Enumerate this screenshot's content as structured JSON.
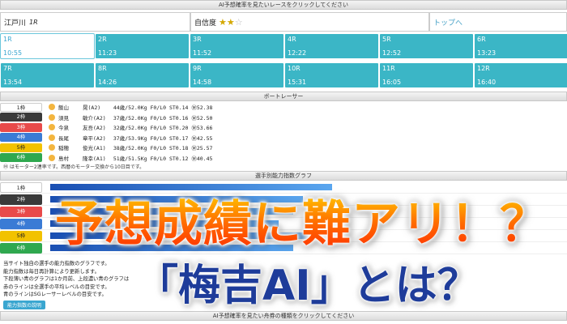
{
  "header": {
    "top_banner": "AI予想確率を見たいレースをクリックしてください",
    "venue": "江戸川",
    "race": "1R",
    "confidence_label": "自信度",
    "confidence_stars": 2,
    "confidence_max": 3,
    "top_link": "トップへ"
  },
  "races": [
    {
      "label": "1R",
      "time": "10:55",
      "active": true
    },
    {
      "label": "2R",
      "time": "11:23"
    },
    {
      "label": "3R",
      "time": "11:52"
    },
    {
      "label": "4R",
      "time": "12:22"
    },
    {
      "label": "5R",
      "time": "12:52"
    },
    {
      "label": "6R",
      "time": "13:23"
    },
    {
      "label": "7R",
      "time": "13:54"
    },
    {
      "label": "8R",
      "time": "14:26"
    },
    {
      "label": "9R",
      "time": "14:58"
    },
    {
      "label": "10R",
      "time": "15:31"
    },
    {
      "label": "11R",
      "time": "16:05"
    },
    {
      "label": "12R",
      "time": "16:40"
    }
  ],
  "racer_section": {
    "title": "ボートレーサー",
    "racers": [
      {
        "boat": "1枠",
        "color": "#ffffff",
        "text_color": "#222222",
        "name": "飯山",
        "class": "晃(A2)",
        "rest": "44歳/52.0Kg F0/L0 ST0.14 Ⓜ52.38"
      },
      {
        "boat": "2枠",
        "color": "#3a3a3a",
        "text_color": "#ffffff",
        "name": "須見",
        "class": "敏介(A2)",
        "rest": "37歳/52.0Kg F0/L0 ST0.16 Ⓜ52.50"
      },
      {
        "boat": "3枠",
        "color": "#e84a4a",
        "text_color": "#ffffff",
        "name": "今泉",
        "class": "友吾(A2)",
        "rest": "32歳/52.0Kg F0/L0 ST0.20 Ⓜ53.66"
      },
      {
        "boat": "4枠",
        "color": "#3a7bd5",
        "text_color": "#ffffff",
        "name": "長尾",
        "class": "章平(A2)",
        "rest": "37歳/53.9Kg F0/L0 ST0.17 Ⓜ42.55"
      },
      {
        "boat": "5枠",
        "color": "#f2c200",
        "text_color": "#222222",
        "name": "稲穂",
        "class": "俊光(A1)",
        "rest": "38歳/52.0Kg F0/L0 ST0.18 Ⓜ25.57"
      },
      {
        "boat": "6枠",
        "color": "#2fa84f",
        "text_color": "#ffffff",
        "name": "島村",
        "class": "隆幸(A1)",
        "rest": "51歳/51.5Kg F0/L0 ST0.12 Ⓜ40.45"
      }
    ],
    "motor_note": "Ⓜ はモーター2連率です。西暦のモーター交換から10日目です。"
  },
  "graph_section": {
    "title": "選手別能力指数グラフ",
    "rows": [
      {
        "boat": "1枠",
        "color": "#ffffff",
        "text_color": "#222222",
        "value": 0.58
      },
      {
        "boat": "2枠",
        "color": "#3a3a3a",
        "text_color": "#ffffff",
        "value": 0.52
      },
      {
        "boat": "3枠",
        "color": "#e84a4a",
        "text_color": "#ffffff",
        "value": 0.5
      },
      {
        "boat": "4枠",
        "color": "#3a7bd5",
        "text_color": "#ffffff",
        "value": 0.47
      },
      {
        "boat": "5枠",
        "color": "#f2c200",
        "text_color": "#222222",
        "value": 0.54
      },
      {
        "boat": "6枠",
        "color": "#2fa84f",
        "text_color": "#ffffff",
        "value": 0.5
      }
    ],
    "desc": [
      "当サイト独自の選手の能力指数のグラフです。",
      "能力指数は毎日再計算により更新します。",
      "下段薄い青のグラフは1か月前、上段濃い青のグラフは",
      "赤のラインは全選手の平均レベルの目安です。",
      "青のラインはSGレーサーレベルの目安です。"
    ],
    "explain_button": "能力指数の説明"
  },
  "bottom_banner": "AI予想確率を見たい舟券の種類をクリックしてください",
  "overlay": {
    "headline": "予想成績に難アリ！？",
    "subline": "「梅吉AI」とは？"
  }
}
